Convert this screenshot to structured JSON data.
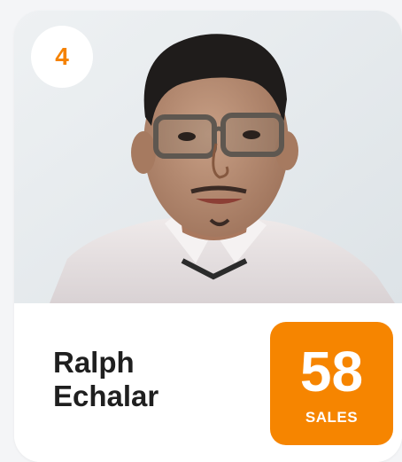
{
  "card": {
    "rank": "4",
    "name_first": "Ralph",
    "name_last": "Echalar",
    "sales_count": "58",
    "sales_label": "SALES"
  },
  "colors": {
    "accent": "#f68500",
    "rank_text": "#f58200",
    "name_text": "#1f1f1f",
    "card_bg": "#ffffff",
    "page_bg": "#f4f5f7"
  }
}
